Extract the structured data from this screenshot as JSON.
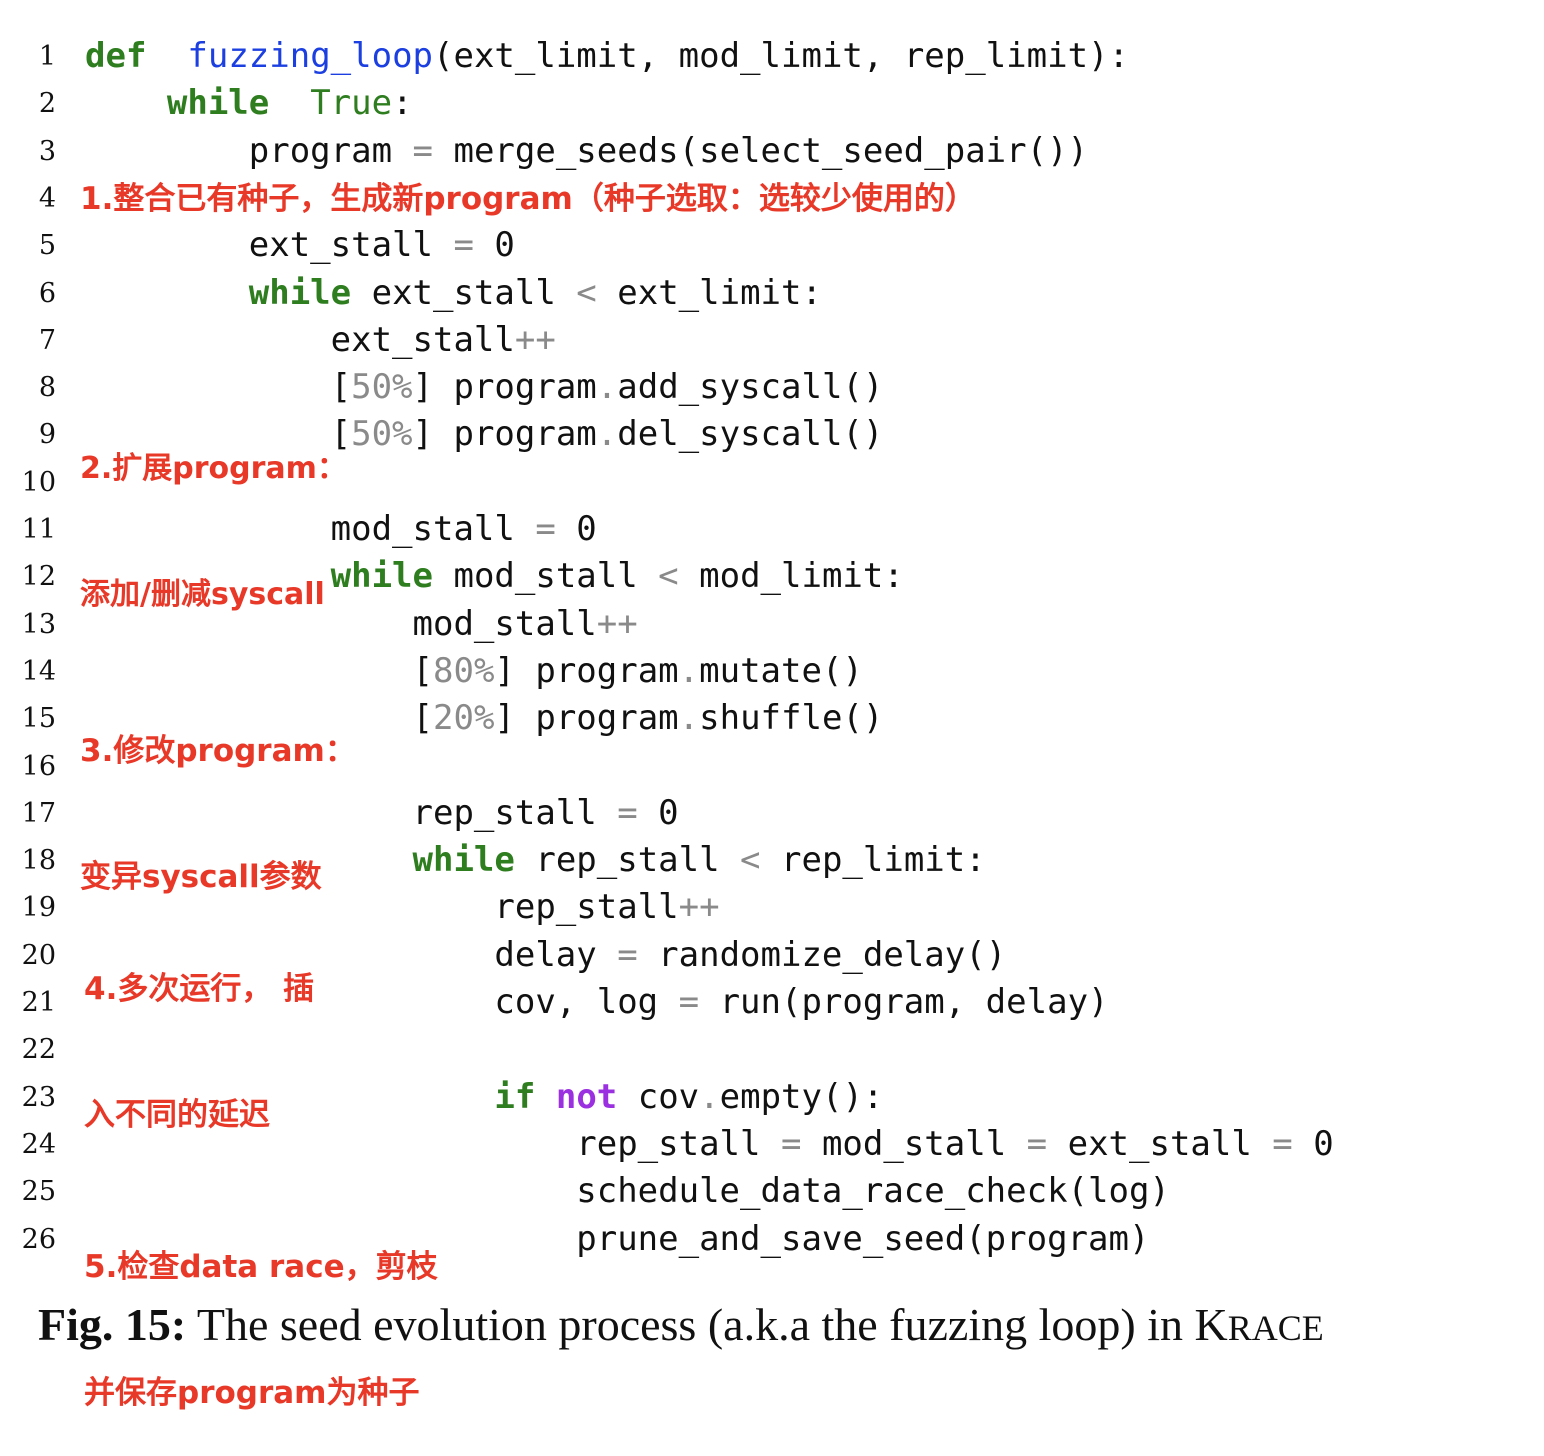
{
  "lines": [
    {
      "n": "1",
      "t": [
        [
          "kw",
          "def"
        ],
        [
          "",
          "  "
        ],
        [
          "fn",
          "fuzzing_loop"
        ],
        [
          "",
          "(ext_limit, mod_limit, rep_limit):"
        ]
      ]
    },
    {
      "n": "2",
      "t": [
        [
          "",
          "    "
        ],
        [
          "kw",
          "while"
        ],
        [
          "",
          "  "
        ],
        [
          "kw2",
          "True"
        ],
        [
          "",
          ":"
        ]
      ]
    },
    {
      "n": "3",
      "t": [
        [
          "",
          "        program "
        ],
        [
          "op",
          "="
        ],
        [
          "",
          " merge_seeds(select_seed_pair())"
        ]
      ]
    },
    {
      "n": "4",
      "t": []
    },
    {
      "n": "5",
      "t": [
        [
          "",
          "        ext_stall "
        ],
        [
          "op",
          "="
        ],
        [
          "",
          " 0"
        ]
      ]
    },
    {
      "n": "6",
      "t": [
        [
          "",
          "        "
        ],
        [
          "kw",
          "while"
        ],
        [
          "",
          " ext_stall "
        ],
        [
          "op",
          "<"
        ],
        [
          "",
          " ext_limit:"
        ]
      ]
    },
    {
      "n": "7",
      "t": [
        [
          "",
          "            ext_stall"
        ],
        [
          "op",
          "++"
        ]
      ]
    },
    {
      "n": "8",
      "t": [
        [
          "",
          "            ["
        ],
        [
          "op",
          "50%"
        ],
        [
          "",
          "] program"
        ],
        [
          "op",
          "."
        ],
        [
          "",
          "add_syscall()"
        ]
      ]
    },
    {
      "n": "9",
      "t": [
        [
          "",
          "            ["
        ],
        [
          "op",
          "50%"
        ],
        [
          "",
          "] program"
        ],
        [
          "op",
          "."
        ],
        [
          "",
          "del_syscall()"
        ]
      ]
    },
    {
      "n": "10",
      "t": []
    },
    {
      "n": "11",
      "t": [
        [
          "",
          "            mod_stall "
        ],
        [
          "op",
          "="
        ],
        [
          "",
          " 0"
        ]
      ]
    },
    {
      "n": "12",
      "t": [
        [
          "",
          "            "
        ],
        [
          "kw",
          "while"
        ],
        [
          "",
          " mod_stall "
        ],
        [
          "op",
          "<"
        ],
        [
          "",
          " mod_limit:"
        ]
      ]
    },
    {
      "n": "13",
      "t": [
        [
          "",
          "                mod_stall"
        ],
        [
          "op",
          "++"
        ]
      ]
    },
    {
      "n": "14",
      "t": [
        [
          "",
          "                ["
        ],
        [
          "op",
          "80%"
        ],
        [
          "",
          "] program"
        ],
        [
          "op",
          "."
        ],
        [
          "",
          "mutate()"
        ]
      ]
    },
    {
      "n": "15",
      "t": [
        [
          "",
          "                ["
        ],
        [
          "op",
          "20%"
        ],
        [
          "",
          "] program"
        ],
        [
          "op",
          "."
        ],
        [
          "",
          "shuffle()"
        ]
      ]
    },
    {
      "n": "16",
      "t": []
    },
    {
      "n": "17",
      "t": [
        [
          "",
          "                rep_stall "
        ],
        [
          "op",
          "="
        ],
        [
          "",
          " 0"
        ]
      ]
    },
    {
      "n": "18",
      "t": [
        [
          "",
          "                "
        ],
        [
          "kw",
          "while"
        ],
        [
          "",
          " rep_stall "
        ],
        [
          "op",
          "<"
        ],
        [
          "",
          " rep_limit:"
        ]
      ]
    },
    {
      "n": "19",
      "t": [
        [
          "",
          "                    rep_stall"
        ],
        [
          "op",
          "++"
        ]
      ]
    },
    {
      "n": "20",
      "t": [
        [
          "",
          "                    delay "
        ],
        [
          "op",
          "="
        ],
        [
          "",
          " randomize_delay()"
        ]
      ]
    },
    {
      "n": "21",
      "t": [
        [
          "",
          "                    cov, log "
        ],
        [
          "op",
          "="
        ],
        [
          "",
          " run(program, delay)"
        ]
      ]
    },
    {
      "n": "22",
      "t": []
    },
    {
      "n": "23",
      "t": [
        [
          "",
          "                    "
        ],
        [
          "kw",
          "if"
        ],
        [
          "",
          " "
        ],
        [
          "kwp",
          "not"
        ],
        [
          "",
          " cov"
        ],
        [
          "op",
          "."
        ],
        [
          "",
          "empty():"
        ]
      ]
    },
    {
      "n": "24",
      "t": [
        [
          "",
          "                        rep_stall "
        ],
        [
          "op",
          "="
        ],
        [
          "",
          " mod_stall "
        ],
        [
          "op",
          "="
        ],
        [
          "",
          " ext_stall "
        ],
        [
          "op",
          "="
        ],
        [
          "",
          " 0"
        ]
      ]
    },
    {
      "n": "25",
      "t": [
        [
          "",
          "                        schedule_data_race_check(log)"
        ]
      ]
    },
    {
      "n": "26",
      "t": [
        [
          "",
          "                        prune_and_save_seed(program)"
        ]
      ]
    }
  ],
  "annotations": {
    "a1": "1.整合已有种子，生成新program（种子选取：选较少使用的）",
    "a2_line1": "2.扩展program：",
    "a2_line2": "添加/删减syscall",
    "a3_line1": "3.修改program：",
    "a3_line2": "变异syscall参数",
    "a4_line1": "4.多次运行， 插",
    "a4_line2": "入不同的延迟",
    "a5_line1": "5.检查data race，剪枝",
    "a5_line2": "并保存program为种子"
  },
  "caption": {
    "label": "Fig. 15:",
    "text": " The seed evolution process (a.k.a the fuzzing loop) in K",
    "smallcaps": "RACE"
  },
  "colors": {
    "keyword": "#2e7d1f",
    "function_name": "#1b3fe0",
    "keyword_not": "#9b30e0",
    "operator": "#8a8a8a",
    "annotation": "#e83828"
  }
}
